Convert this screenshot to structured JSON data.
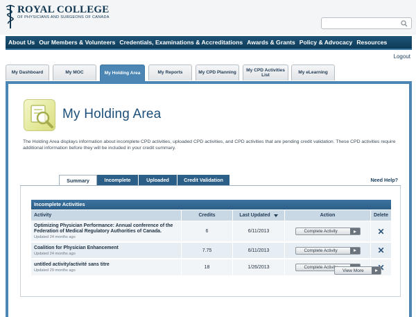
{
  "logo": {
    "title": "ROYAL COLLEGE",
    "subtitle": "OF PHYSICIANS AND SURGEONS OF CANADA"
  },
  "search": {
    "placeholder": ""
  },
  "main_nav": [
    "About Us",
    "Our Members & Volunteers",
    "Credentials, Examinations & Accreditations",
    "Awards & Grants",
    "Policy & Advocacy",
    "Resources"
  ],
  "logout": "Logout",
  "tabs": [
    {
      "label": "My Dashboard",
      "active": false
    },
    {
      "label": "My MOC",
      "active": false
    },
    {
      "label": "My Holding Area",
      "active": true
    },
    {
      "label": "My Reports",
      "active": false
    },
    {
      "label": "My CPD Planning",
      "active": false
    },
    {
      "label": "My CPD Activities List",
      "active": false
    },
    {
      "label": "My eLearning",
      "active": false
    }
  ],
  "page": {
    "title": "My Holding Area",
    "intro": "The Holding Area displays information about incomplete CPD activities, uploaded CPD activities, and CPD activities that are pending credit validation. These CPD activities require additional information before they will be included in your credit summary."
  },
  "sub_tabs": [
    {
      "label": "Summary",
      "selected": true
    },
    {
      "label": "Incomplete",
      "selected": false
    },
    {
      "label": "Uploaded",
      "selected": false
    },
    {
      "label": "Credit Validation",
      "selected": false
    }
  ],
  "need_help": "Need Help?",
  "table": {
    "title": "Incomplete Activities",
    "columns": [
      "Activity",
      "Credits",
      "Last Updated",
      "Action",
      "Delete"
    ],
    "rows": [
      {
        "activity": "Optimizing Physician Performance: Annual conference of the Federation of Medical Regulatory Authorities of Canada.",
        "updated": "Updated 24 months ago",
        "credits": "6",
        "last_updated": "6/11/2013",
        "action": "Complete Activity"
      },
      {
        "activity": "Coalition for Physician Enhancement",
        "updated": "Updated 24 months ago",
        "credits": "7.75",
        "last_updated": "6/11/2013",
        "action": "Complete Activity"
      },
      {
        "activity": "untitled activity/activité sans titre",
        "updated": "Updated 29 months ago",
        "credits": "18",
        "last_updated": "1/26/2013",
        "action": "Complete Activity"
      }
    ],
    "view_more": "View More"
  },
  "colors": {
    "nav_bg": "#0e3a58",
    "accent": "#4b86b4",
    "table_header": "#2b5f87",
    "title_text": "#1d4f78"
  },
  "icons": {
    "logo": "caduceus-icon",
    "search": "search-icon",
    "hero": "magnifier-document-icon",
    "delete": "close-x-icon",
    "button_arrow": "arrow-right-icon"
  }
}
